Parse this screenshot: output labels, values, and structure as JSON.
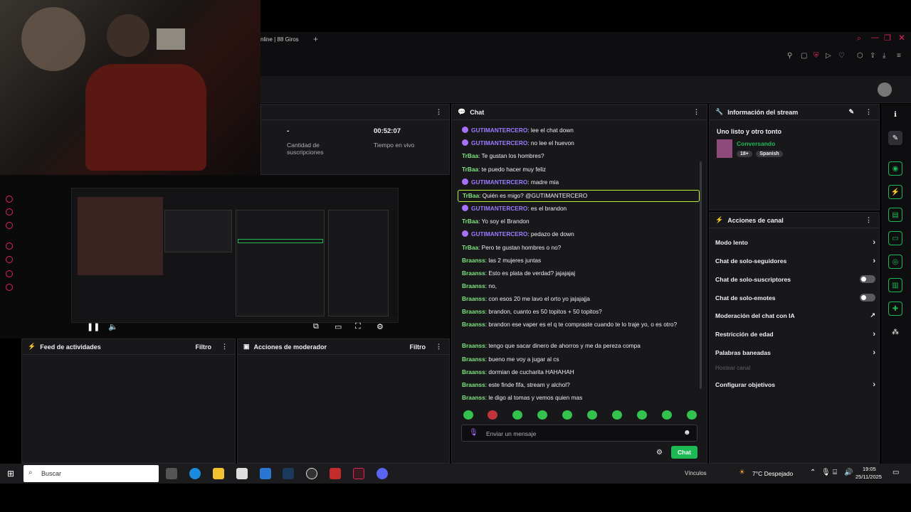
{
  "browser": {
    "tab_title": "nline | 88 Giros",
    "new_tab": "+"
  },
  "stats": {
    "subs_value": "-",
    "subs_label": "Cantidad de suscripciones",
    "time_value": "00:52:07",
    "time_label": "Tiempo en vivo"
  },
  "feed": {
    "title": "Feed de actividades",
    "filter": "Filtro"
  },
  "mod_actions": {
    "title": "Acciones de moderador",
    "filter": "Filtro"
  },
  "chat": {
    "title": "Chat",
    "messages": [
      {
        "user": "GUTIMANTERCERO",
        "text": ": lee el chat down",
        "type": "b"
      },
      {
        "user": "GUTIMANTERCERO",
        "text": ": no lee el huevon",
        "type": "b"
      },
      {
        "user": "TrBaa",
        "text": ": Te gustan los hombres?",
        "type": "g"
      },
      {
        "user": "TrBaa",
        "text": ": te puedo hacer muy feliz",
        "type": "g"
      },
      {
        "user": "GUTIMANTERCERO",
        "text": ": madre mia",
        "type": "b"
      },
      {
        "user": "TrBaa",
        "text": ": Quién es migo? @GUTIMANTERCERO",
        "type": "g"
      },
      {
        "user": "GUTIMANTERCERO",
        "text": ": es el brandon",
        "type": "b"
      },
      {
        "user": "TrBaa",
        "text": ": Yo soy el Brandon",
        "type": "g"
      },
      {
        "user": "GUTIMANTERCERO",
        "text": ": pedazo de down",
        "type": "b"
      },
      {
        "user": "TrBaa",
        "text": ": Pero te gustan hombres o no?",
        "type": "g"
      },
      {
        "user": "Braanss",
        "text": ": las 2 mujeres juntas",
        "type": "g"
      },
      {
        "user": "Braanss",
        "text": ": Esto es plata de verdad? jajajajaj",
        "type": "g"
      },
      {
        "user": "Braanss",
        "text": ": no,",
        "type": "g"
      },
      {
        "user": "Braanss",
        "text": ": con esos 20 me lavo el orto yo jajajajja",
        "type": "g"
      },
      {
        "user": "Braanss",
        "text": ": brandon, cuanto es 50 topitos + 50 topitos?",
        "type": "g"
      },
      {
        "user": "Braanss",
        "text": ": brandon ese vaper es el q te compraste cuando te lo traje yo, o es otro?",
        "type": "g"
      },
      {
        "user": "Braanss",
        "text": ": tengo que sacar dinero de ahorros y me da pereza compa",
        "type": "g"
      },
      {
        "user": "Braanss",
        "text": ": bueno me voy a jugar al cs",
        "type": "g"
      },
      {
        "user": "Braanss",
        "text": ": dormian de cucharita HAHAHAH",
        "type": "g"
      },
      {
        "user": "Braanss",
        "text": ": este finde fifa, stream y alchol?",
        "type": "g"
      },
      {
        "user": "Braanss",
        "text": ": le digo al tomas y vemos quien mas",
        "type": "g"
      }
    ],
    "input_placeholder": "Enviar un mensaje",
    "send_label": "Chat"
  },
  "stream_info": {
    "header": "Información del stream",
    "title": "Uno listo y otro tonto",
    "category": "Conversando",
    "tags": [
      "18+",
      "Spanish"
    ]
  },
  "channel_actions": {
    "header": "Acciones de canal",
    "rows": [
      {
        "label": "Modo lento",
        "control": "chevron"
      },
      {
        "label": "Chat de solo-seguidores",
        "control": "chevron"
      },
      {
        "label": "Chat de solo-suscriptores",
        "control": "toggle"
      },
      {
        "label": "Chat de solo-emotes",
        "control": "toggle"
      },
      {
        "label": "Moderación del chat con IA",
        "control": "external"
      },
      {
        "label": "Restricción de edad",
        "control": "chevron"
      },
      {
        "label": "Palabras baneadas",
        "control": "chevron"
      },
      {
        "label": "Hostear canal",
        "control": "disabled"
      },
      {
        "label": "Configurar objetivos",
        "control": "chevron"
      }
    ]
  },
  "taskbar": {
    "search_placeholder": "Buscar",
    "links": "Vínculos",
    "weather": "7°C Despejado",
    "time": "19:05",
    "date": "25/11/2025"
  },
  "colors": {
    "accent_green": "#1db954",
    "accent_purple": "#a970ff",
    "panel_bg": "#18181b"
  }
}
